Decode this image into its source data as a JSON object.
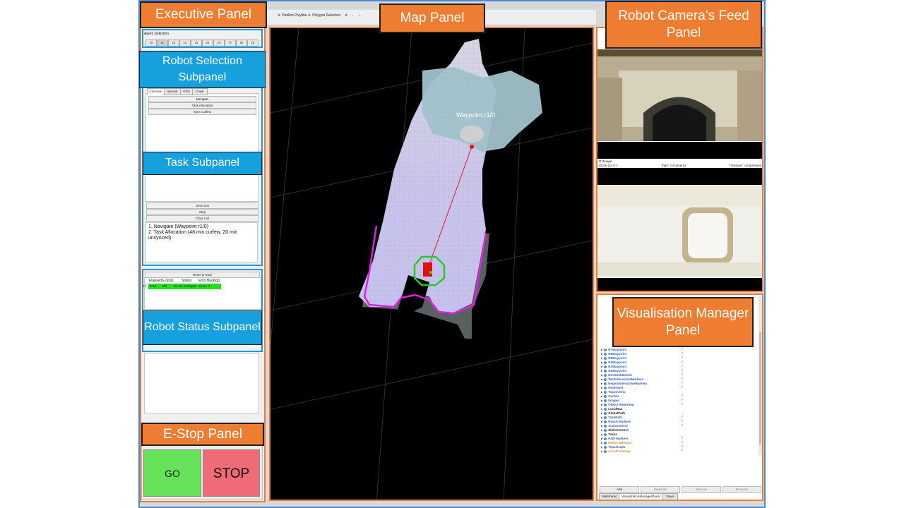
{
  "toolbar": {
    "items": [
      "Publish Polyline",
      "Polygon Selection"
    ]
  },
  "callouts": {
    "executive": "Executive Panel",
    "map": "Map Panel",
    "camera": "Robot Camera’s Feed Panel",
    "visualisation": "Visualisation Manager Panel",
    "estop": "E-Stop Panel",
    "robot_selection": "Robot Selection Subpanel",
    "task": "Task Subpanel",
    "robot_status": "Robot Status Subpanel"
  },
  "agent_selection": {
    "label": "Agent Selection",
    "agents": [
      "r0",
      "r1",
      "r2",
      "r3",
      "r4",
      "r5",
      "r6",
      "r7",
      "r8",
      "r9"
    ],
    "selected": "r1"
  },
  "task_tabs": [
    "Common",
    "Special",
    "GPS",
    "Cover"
  ],
  "task_buttons": [
    "Navigate",
    "Task Allocation",
    "Sync Collect"
  ],
  "list_buttons": [
    "Send List",
    "Stop",
    "Clear List"
  ],
  "task_list": [
    "1. Navigate (Waypoint r1/0)",
    "2. Task Allocation (48 min curfew, 20 min unsynced)"
  ],
  "status": {
    "reset_label": "Reset E-Stop",
    "headers": [
      "Elapsed",
      "E-Stop",
      "Status",
      "Error",
      "Backlog"
    ],
    "row": {
      "id": "r1",
      "elapsed": "0:13",
      "estop": "Off",
      "status": "CL 0/1 Navigate",
      "error": "None",
      "backlog": "0"
    }
  },
  "estop": {
    "go": "GO",
    "stop": "STOP"
  },
  "map": {
    "waypoint_label": "Waypoint r1/0"
  },
  "camera": {
    "second_image_title": "R1Image",
    "clock": "Clock (s): 0.1",
    "topic": "Topic: r1/camera2",
    "transport": "Transport: compressed"
  },
  "viz": {
    "items": [
      {
        "name": "R7Waypoint",
        "checked": true,
        "color": "#2f5fb3"
      },
      {
        "name": "R8Waypoint",
        "checked": true,
        "color": "#2f5fb3"
      },
      {
        "name": "R9Waypoint",
        "checked": true,
        "color": "#2f5fb3"
      },
      {
        "name": "R0Waypoint",
        "checked": true,
        "color": "#2f5fb3"
      },
      {
        "name": "R1Waypoint",
        "checked": true,
        "color": "#2f5fb3"
      },
      {
        "name": "R2Waypoint",
        "checked": true,
        "color": "#2f5fb3"
      },
      {
        "name": "NewTaskMarker",
        "checked": true,
        "color": "#2f5fb3"
      },
      {
        "name": "TaskInteractiveMarkers",
        "checked": true,
        "color": "#2f5fb3"
      },
      {
        "name": "RegionInteractiveMarkers",
        "checked": true,
        "color": "#2f5fb3"
      },
      {
        "name": "HintPanel",
        "checked": true,
        "color": "#2f5fb3"
      },
      {
        "name": "Topometric",
        "checked": false,
        "color": "#2f5fb3"
      },
      {
        "name": "Surfels",
        "checked": true,
        "color": "#2f5fb3"
      },
      {
        "name": "Images",
        "checked": true,
        "color": "#2f5fb3"
      },
      {
        "name": "Object Reporting",
        "checked": true,
        "color": "#2f5fb3"
      },
      {
        "name": "LocalNav",
        "checked": false,
        "color": "#222222"
      },
      {
        "name": "GlobalPath",
        "checked": false,
        "color": "#222222"
      },
      {
        "name": "TaskPath",
        "checked": true,
        "color": "#2f5fb3"
      },
      {
        "name": "Reach Markers",
        "checked": true,
        "color": "#2f5fb3"
      },
      {
        "name": "ScanContext",
        "checked": true,
        "color": "#2f5fb3"
      },
      {
        "name": "SliderControl",
        "checked": false,
        "color": "#222222"
      },
      {
        "name": "Tasks",
        "checked": false,
        "color": "#222222"
      },
      {
        "name": "Path Markers",
        "checked": true,
        "color": "#2f5fb3"
      },
      {
        "name": "Robot Indicator",
        "checked": true,
        "color": "#d9822b"
      },
      {
        "name": "TopoGraph",
        "checked": true,
        "color": "#2f5fb3"
      },
      {
        "name": "LocalCostmap",
        "checked": true,
        "color": "#d9822b"
      }
    ],
    "buttons": [
      "Add",
      "Duplicate",
      "Remove",
      "Rename"
    ],
    "bottom_tabs": [
      "MulePanel",
      "VisualizationManagerPanel",
      "Views"
    ]
  }
}
